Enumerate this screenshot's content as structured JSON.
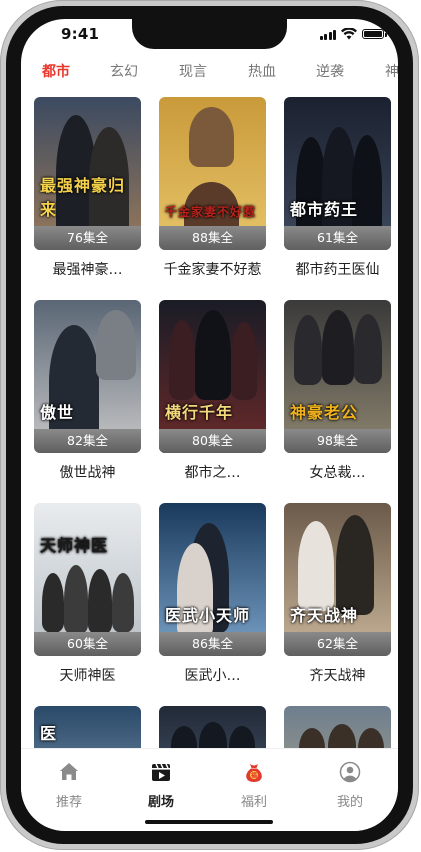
{
  "status_bar": {
    "time": "9:41"
  },
  "categories": [
    {
      "label": "都市",
      "active": true
    },
    {
      "label": "玄幻",
      "active": false
    },
    {
      "label": "现言",
      "active": false
    },
    {
      "label": "热血",
      "active": false
    },
    {
      "label": "逆袭",
      "active": false
    },
    {
      "label": "神",
      "active": false
    }
  ],
  "dramas": [
    {
      "title": "最强神豪…",
      "episodes": "76集全",
      "art_title": "最强神豪归来",
      "colors": [
        "#3b4a61",
        "#9a7a5a"
      ],
      "title_color": "#f6d24a"
    },
    {
      "title": "千金家妻不好惹",
      "episodes": "88集全",
      "art_title": "千金家妻不好惹",
      "colors": [
        "#c99a3a",
        "#e7c56a"
      ],
      "title_color": "#b8221b"
    },
    {
      "title": "都市药王医仙",
      "episodes": "61集全",
      "art_title": "都市药王",
      "colors": [
        "#1b2130",
        "#3e4a5d"
      ],
      "title_color": "#ffffff"
    },
    {
      "title": "傲世战神",
      "episodes": "82集全",
      "art_title": "傲世",
      "colors": [
        "#5a6675",
        "#c8c8c8"
      ],
      "title_color": "#ffffff"
    },
    {
      "title": "都市之…",
      "episodes": "80集全",
      "art_title": "横行千年",
      "colors": [
        "#1a1c26",
        "#6b2a2a"
      ],
      "title_color": "#f3d77a"
    },
    {
      "title": "女总裁…",
      "episodes": "98集全",
      "art_title": "神豪老公",
      "colors": [
        "#3a3a3a",
        "#8d8570"
      ],
      "title_color": "#f1b21d"
    },
    {
      "title": "天师神医",
      "episodes": "60集全",
      "art_title": "天师神医",
      "colors": [
        "#e8ecef",
        "#b8bec4"
      ],
      "title_color": "#1b1b1b"
    },
    {
      "title": "医武小…",
      "episodes": "86集全",
      "art_title": "医武小天师",
      "colors": [
        "#1a3a5c",
        "#7aa2c8"
      ],
      "title_color": "#ffffff"
    },
    {
      "title": "齐天战神",
      "episodes": "62集全",
      "art_title": "齐天战神",
      "colors": [
        "#6b5a4a",
        "#c9b59a"
      ],
      "title_color": "#ffffff"
    }
  ],
  "partial_row": [
    {
      "art_title": "医",
      "colors": [
        "#2a4a6a",
        "#9ab0c0"
      ]
    },
    {
      "art_title": "",
      "colors": [
        "#222a38",
        "#5a6e85"
      ]
    },
    {
      "art_title": "",
      "colors": [
        "#6e7e8e",
        "#c2b48a"
      ]
    }
  ],
  "tab_bar": [
    {
      "label": "推荐",
      "icon": "home-icon",
      "active": false
    },
    {
      "label": "剧场",
      "icon": "clapperboard-icon",
      "active": true
    },
    {
      "label": "福利",
      "icon": "lucky-bag-icon",
      "active": false
    },
    {
      "label": "我的",
      "icon": "profile-icon",
      "active": false
    }
  ],
  "colors": {
    "accent": "#e8372b",
    "welfare": "#e23a2b"
  }
}
